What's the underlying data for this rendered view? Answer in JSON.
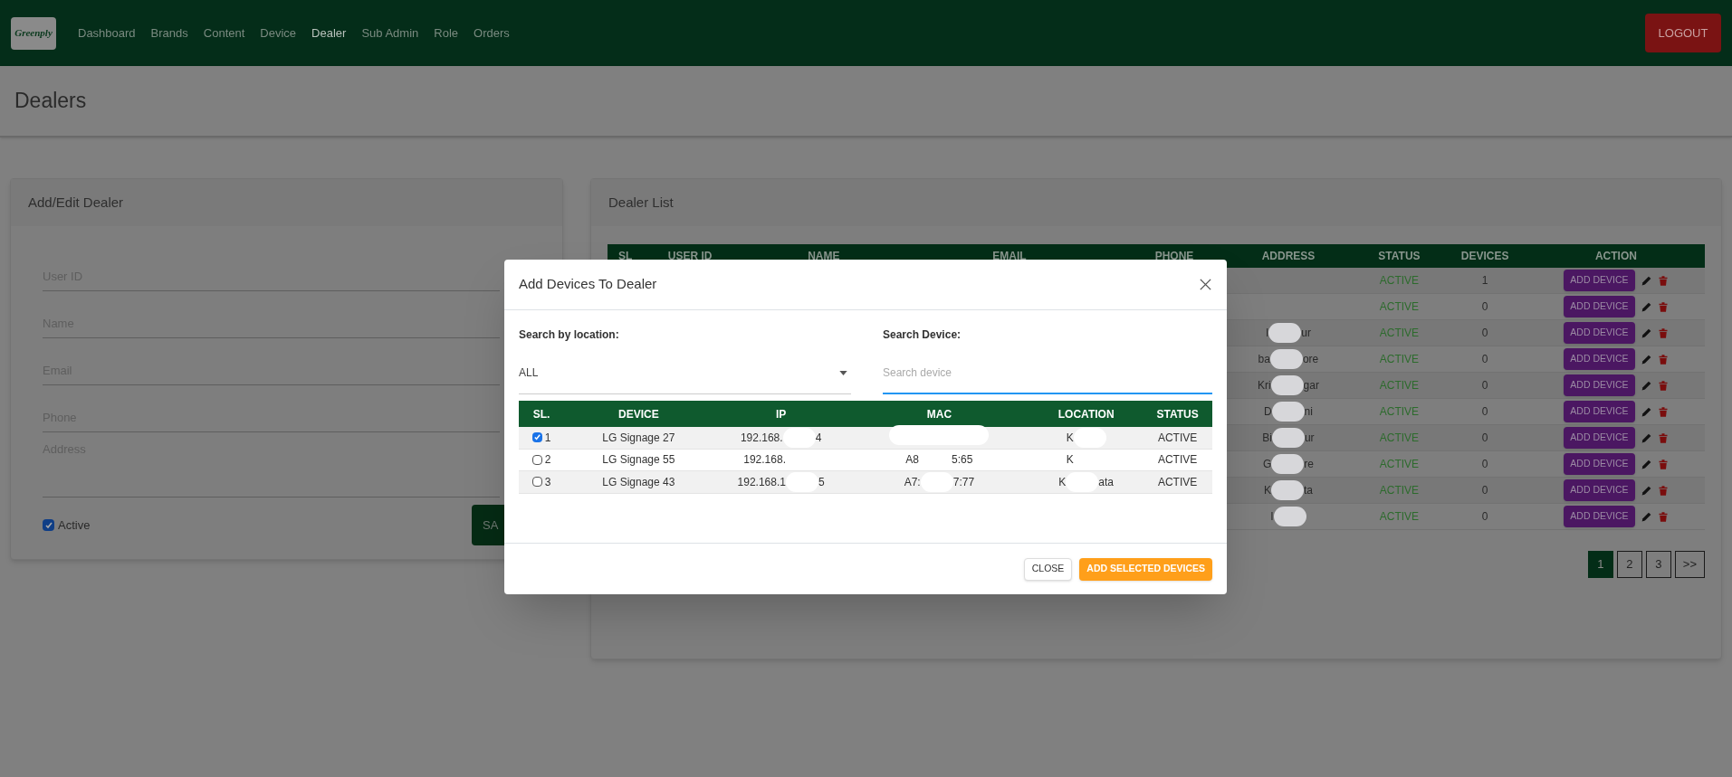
{
  "nav": {
    "logo": "Greenply",
    "items": [
      {
        "label": "Dashboard",
        "selected": false
      },
      {
        "label": "Brands",
        "selected": false
      },
      {
        "label": "Content",
        "selected": false
      },
      {
        "label": "Device",
        "selected": false
      },
      {
        "label": "Dealer",
        "selected": true
      },
      {
        "label": "Sub Admin",
        "selected": false
      },
      {
        "label": "Role",
        "selected": false
      },
      {
        "label": "Orders",
        "selected": false
      }
    ],
    "logout": "LOGOUT"
  },
  "page_title": "Dealers",
  "form": {
    "title": "Add/Edit Dealer",
    "fields": [
      {
        "placeholder": "User ID",
        "kind": "line"
      },
      {
        "placeholder": "Name",
        "kind": "line"
      },
      {
        "placeholder": "Email",
        "kind": "line"
      },
      {
        "placeholder": "Phone",
        "kind": "line"
      },
      {
        "placeholder": "Address",
        "kind": "area"
      }
    ],
    "active": {
      "label": "Active",
      "checked": true
    },
    "save": "SA"
  },
  "dealer_list": {
    "title": "Dealer List",
    "columns": [
      "SL",
      "USER ID",
      "NAME",
      "EMAIL",
      "PHONE",
      "ADDRESS",
      "STATUS",
      "DEVICES",
      "ACTION"
    ],
    "rows": [
      {
        "address": [],
        "status": "ACTIVE",
        "devices": "1",
        "action": "ADD DEVICE"
      },
      {
        "address": [],
        "status": "ACTIVE",
        "devices": "0",
        "action": "ADD DEVICE"
      },
      {
        "address": [
          {
            "kind": "text",
            "text": "I"
          },
          {
            "kind": "blob"
          },
          {
            "kind": "text",
            "text": "ur"
          }
        ],
        "status": "ACTIVE",
        "devices": "0",
        "action": "ADD DEVICE"
      },
      {
        "address": [
          {
            "kind": "text",
            "text": "ba"
          },
          {
            "kind": "blob"
          },
          {
            "kind": "text",
            "text": "ore"
          }
        ],
        "status": "ACTIVE",
        "devices": "0",
        "action": "ADD DEVICE"
      },
      {
        "address": [
          {
            "kind": "text",
            "text": "Kri"
          },
          {
            "kind": "blob"
          },
          {
            "kind": "text",
            "text": "gar"
          }
        ],
        "status": "ACTIVE",
        "devices": "0",
        "action": "ADD DEVICE"
      },
      {
        "address": [
          {
            "kind": "text",
            "text": "D"
          },
          {
            "kind": "blob"
          },
          {
            "kind": "text",
            "text": "ni"
          }
        ],
        "status": "ACTIVE",
        "devices": "0",
        "action": "ADD DEVICE"
      },
      {
        "address": [
          {
            "kind": "text",
            "text": "Bi"
          },
          {
            "kind": "blob"
          },
          {
            "kind": "text",
            "text": "ur"
          }
        ],
        "status": "ACTIVE",
        "devices": "0",
        "action": "ADD DEVICE"
      },
      {
        "address": [
          {
            "kind": "text",
            "text": "G"
          },
          {
            "kind": "blob"
          },
          {
            "kind": "text",
            "text": "re"
          }
        ],
        "status": "ACTIVE",
        "devices": "0",
        "action": "ADD DEVICE"
      },
      {
        "address": [
          {
            "kind": "text",
            "text": "K"
          },
          {
            "kind": "blob"
          },
          {
            "kind": "text",
            "text": "ta"
          }
        ],
        "status": "ACTIVE",
        "devices": "0",
        "action": "ADD DEVICE"
      },
      {
        "address": [
          {
            "kind": "text",
            "text": "I"
          },
          {
            "kind": "blob"
          }
        ],
        "status": "ACTIVE",
        "devices": "0",
        "action": "ADD DEVICE"
      }
    ],
    "pages": [
      {
        "label": "1",
        "selected": true
      },
      {
        "label": "2",
        "selected": false
      },
      {
        "label": "3",
        "selected": false
      },
      {
        "label": ">>",
        "selected": false
      }
    ]
  },
  "modal": {
    "title": "Add Devices To Dealer",
    "location_label": "Search by location:",
    "location_value": "ALL",
    "search_label": "Search Device:",
    "search_placeholder": "Search device",
    "columns": [
      "SL.",
      "DEVICE",
      "IP",
      "MAC",
      "LOCATION",
      "STATUS"
    ],
    "rows": [
      {
        "sl": "1",
        "checked": true,
        "device": "LG Signage 27",
        "ip": [
          {
            "kind": "text",
            "text": "192.168."
          },
          {
            "kind": "blob"
          },
          {
            "kind": "text",
            "text": "4"
          }
        ],
        "mac": [
          {
            "kind": "blob"
          }
        ],
        "location": [
          {
            "kind": "text",
            "text": "K"
          },
          {
            "kind": "blob"
          }
        ],
        "status": "ACTIVE"
      },
      {
        "sl": "2",
        "checked": false,
        "device": "LG Signage 55",
        "ip": [
          {
            "kind": "text",
            "text": "192.168."
          },
          {
            "kind": "blob"
          }
        ],
        "mac": [
          {
            "kind": "text",
            "text": "A8"
          },
          {
            "kind": "blob"
          },
          {
            "kind": "text",
            "text": "5:65"
          }
        ],
        "location": [
          {
            "kind": "text",
            "text": "K"
          },
          {
            "kind": "blob"
          }
        ],
        "status": "ACTIVE"
      },
      {
        "sl": "3",
        "checked": false,
        "device": "LG Signage 43",
        "ip": [
          {
            "kind": "text",
            "text": "192.168.1"
          },
          {
            "kind": "blob"
          },
          {
            "kind": "text",
            "text": "5"
          }
        ],
        "mac": [
          {
            "kind": "text",
            "text": "A7:"
          },
          {
            "kind": "blob"
          },
          {
            "kind": "text",
            "text": "7:77"
          }
        ],
        "location": [
          {
            "kind": "text",
            "text": "K"
          },
          {
            "kind": "blob"
          },
          {
            "kind": "text",
            "text": "ata"
          }
        ],
        "status": "ACTIVE"
      }
    ],
    "close": "CLOSE",
    "submit": "ADD SELECTED DEVICES"
  }
}
